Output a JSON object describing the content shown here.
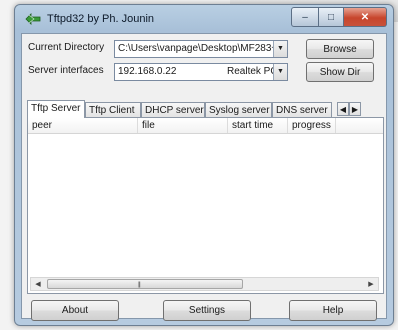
{
  "window": {
    "title": "Tftpd32 by Ph. Jounin",
    "minimize_icon": "–",
    "maximize_icon": "□",
    "close_icon": "✕"
  },
  "directory": {
    "label": "Current Directory",
    "value": "C:\\Users\\vanpage\\Desktop\\MF283+",
    "dropdown_icon": "▼",
    "browse_label": "Browse"
  },
  "interfaces": {
    "label": "Server interfaces",
    "ip": "192.168.0.22",
    "adapter": "Realtek PC",
    "dropdown_icon": "▼",
    "show_dir_label": "Show Dir"
  },
  "tabs": [
    {
      "label": "Tftp Server",
      "active": true
    },
    {
      "label": "Tftp Client",
      "active": false
    },
    {
      "label": "DHCP server",
      "active": false
    },
    {
      "label": "Syslog server",
      "active": false
    },
    {
      "label": "DNS server",
      "active": false
    }
  ],
  "tab_scroll": {
    "left": "◀",
    "right": "▶"
  },
  "table": {
    "columns": [
      "peer",
      "file",
      "start time",
      "progress"
    ],
    "rows": []
  },
  "hscroll": {
    "left": "◀",
    "right": "▶",
    "grip": "|||"
  },
  "buttons": {
    "about": "About",
    "settings": "Settings",
    "help": "Help"
  }
}
